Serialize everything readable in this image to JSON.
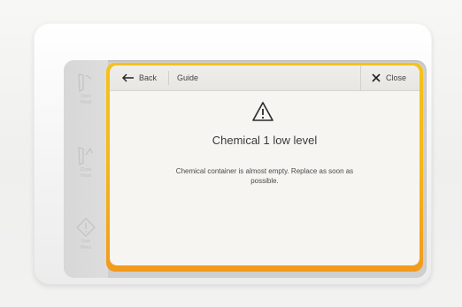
{
  "colors": {
    "frame_accent_top": "#f5c21a",
    "frame_accent_bottom": "#f29a1e",
    "screen_background": "#f6f5f1",
    "text": "#3a3a3a"
  },
  "side_rail": {
    "items": [
      {
        "icon": "open-hood-icon",
        "label": "Open\nHood"
      },
      {
        "icon": "close-hood-icon",
        "label": "Close\nHood"
      },
      {
        "icon": "info-diamond-icon",
        "label": "User\nMenu"
      }
    ]
  },
  "topbar": {
    "back_icon": "arrow-left-icon",
    "back_label": "Back",
    "crumb": "Guide",
    "close_icon": "close-icon",
    "close_label": "Close"
  },
  "alert": {
    "icon": "warning-triangle-icon",
    "title": "Chemical 1 low level",
    "message": "Chemical container is almost empty. Replace as soon as possible."
  }
}
